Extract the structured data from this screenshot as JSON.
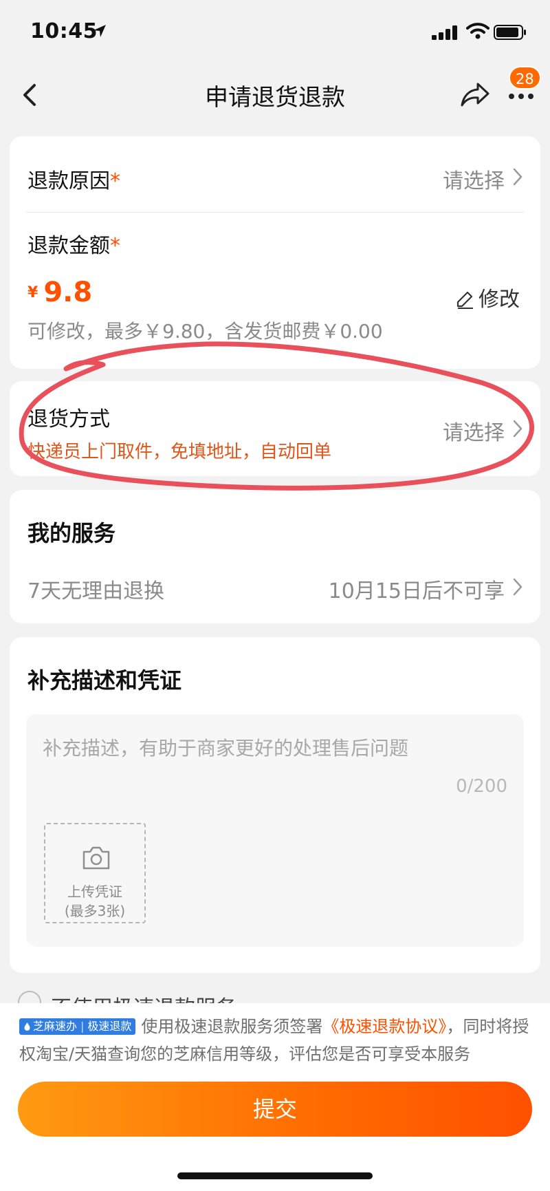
{
  "status_bar": {
    "time": "10:45"
  },
  "nav": {
    "title": "申请退货退款",
    "badge": "28"
  },
  "reason": {
    "label": "退款原因",
    "required": "*",
    "value": "请选择"
  },
  "amount": {
    "label": "退款金额",
    "required": "*",
    "currency": "¥",
    "value": "9.8",
    "edit_label": "修改",
    "note": "可修改，最多￥9.80，含发货邮费￥0.00"
  },
  "method": {
    "label": "退货方式",
    "sub": "快递员上门取件，免填地址，自动回单",
    "value": "请选择"
  },
  "service": {
    "title": "我的服务",
    "item_label": "7天无理由退换",
    "item_value": "10月15日后不可享"
  },
  "description": {
    "title": "补充描述和凭证",
    "placeholder": "补充描述，有助于商家更好的处理售后问题",
    "counter": "0/200",
    "upload_line1": "上传凭证",
    "upload_line2": "(最多3张)"
  },
  "partial_option": {
    "label": "不使用极速退款服务"
  },
  "agreement": {
    "tag_left": "芝麻速办",
    "tag_right": "极速退款",
    "text_pre": "使用极速退款服务须签署",
    "link": "《极速退款协议》",
    "text_post": "，同时将授权淘宝/天猫查询您的芝麻信用等级，评估您是否可享受本服务"
  },
  "submit_label": "提交",
  "colors": {
    "accent": "#ff5000",
    "tag_blue": "#2f7de1",
    "annotation": "#e8505b"
  }
}
